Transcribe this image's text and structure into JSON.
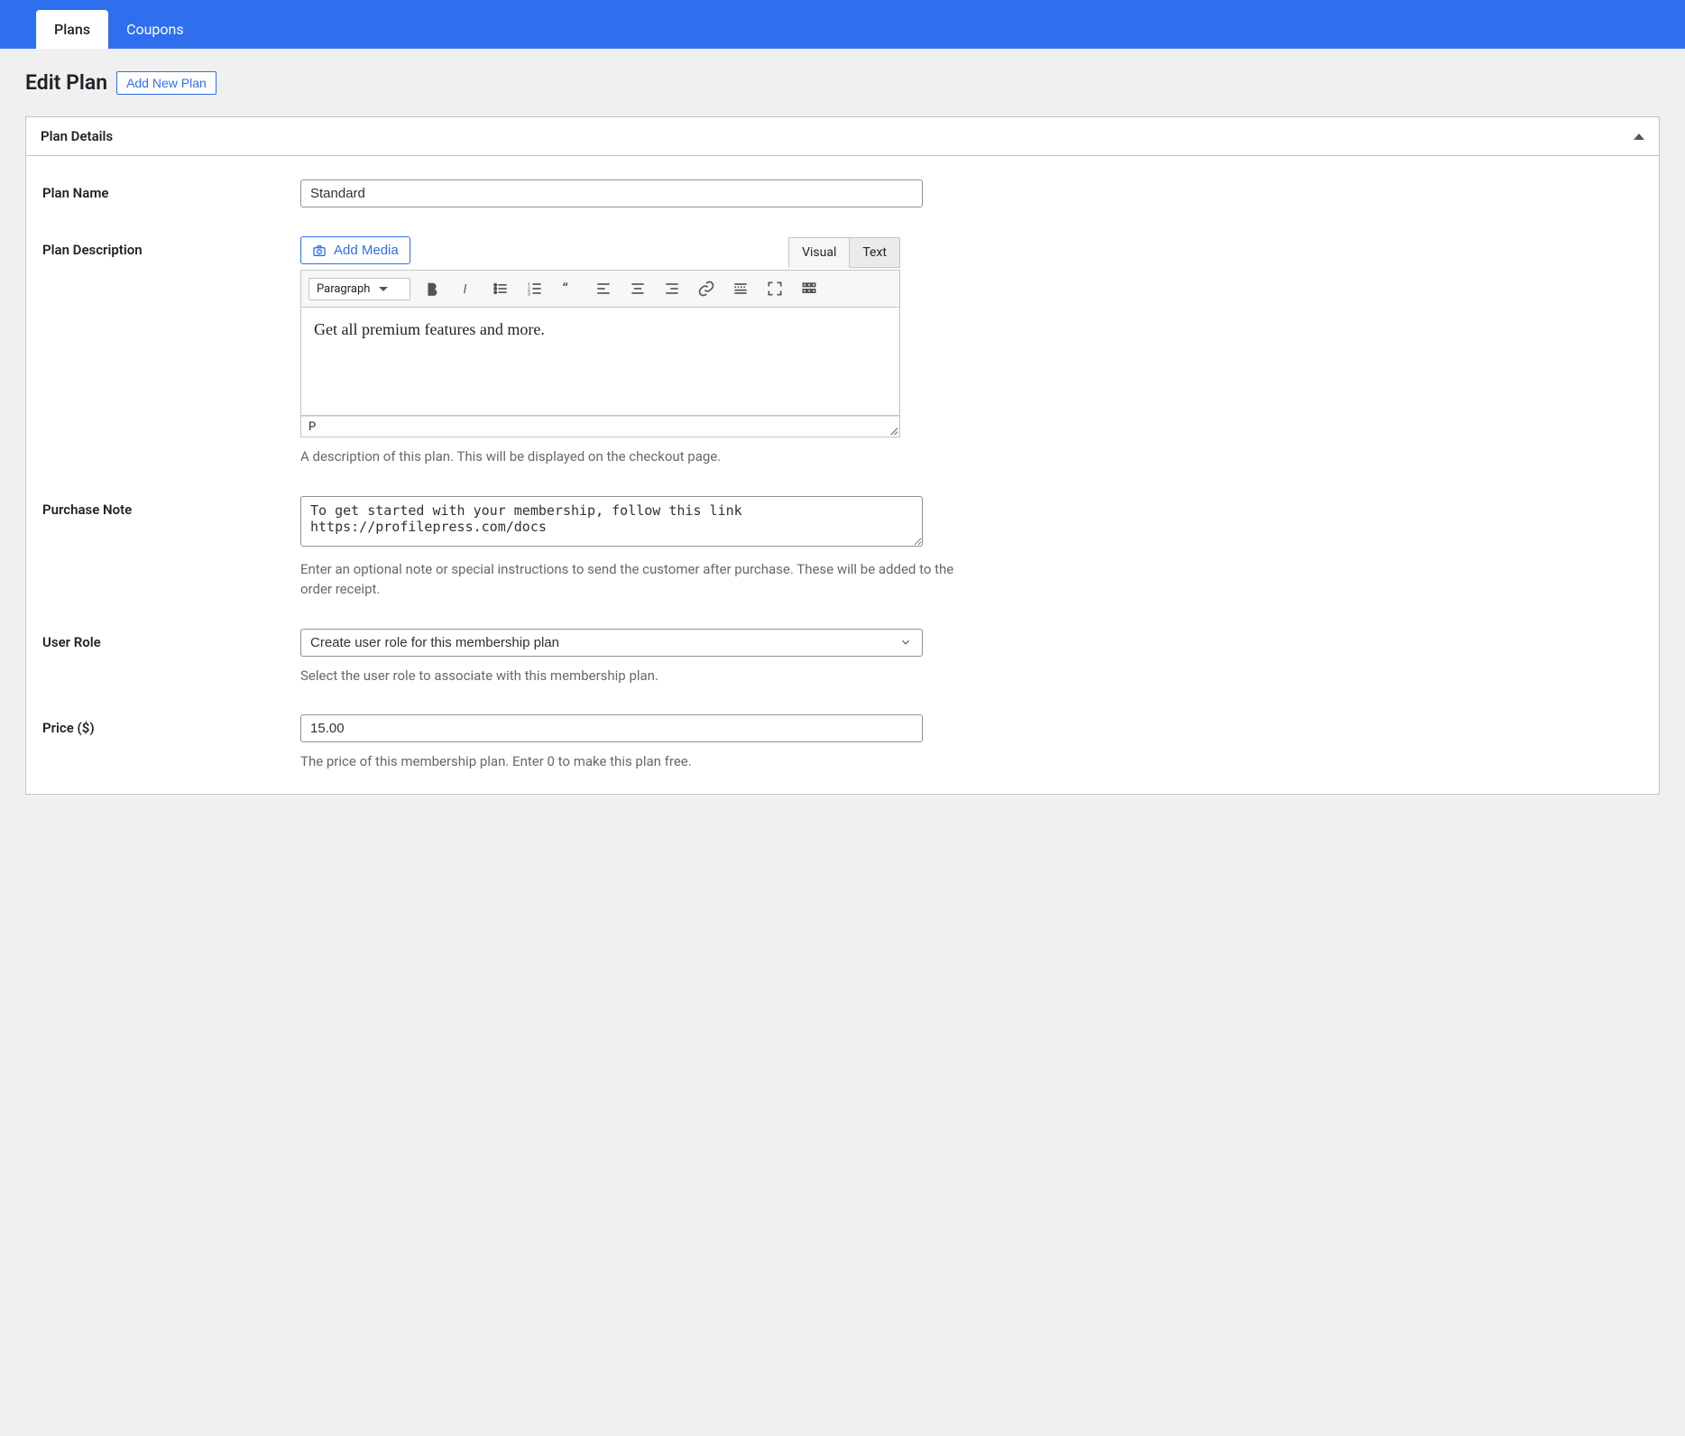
{
  "tabs": {
    "plans": "Plans",
    "coupons": "Coupons"
  },
  "page": {
    "title": "Edit Plan",
    "add_new_label": "Add New Plan"
  },
  "panel": {
    "title": "Plan Details"
  },
  "fields": {
    "plan_name": {
      "label": "Plan Name",
      "value": "Standard"
    },
    "plan_description": {
      "label": "Plan Description",
      "add_media_label": "Add Media",
      "editor_tabs": {
        "visual": "Visual",
        "text": "Text"
      },
      "format_label": "Paragraph",
      "content": "Get all premium features and more.",
      "status_path": "P",
      "helper": "A description of this plan. This will be displayed on the checkout page."
    },
    "purchase_note": {
      "label": "Purchase Note",
      "value": "To get started with your membership, follow this link https://profilepress.com/docs",
      "helper": "Enter an optional note or special instructions to send the customer after purchase. These will be added to the order receipt."
    },
    "user_role": {
      "label": "User Role",
      "value": "Create user role for this membership plan",
      "helper": "Select the user role to associate with this membership plan."
    },
    "price": {
      "label": "Price ($)",
      "value": "15.00",
      "helper": "The price of this membership plan. Enter 0 to make this plan free."
    }
  }
}
